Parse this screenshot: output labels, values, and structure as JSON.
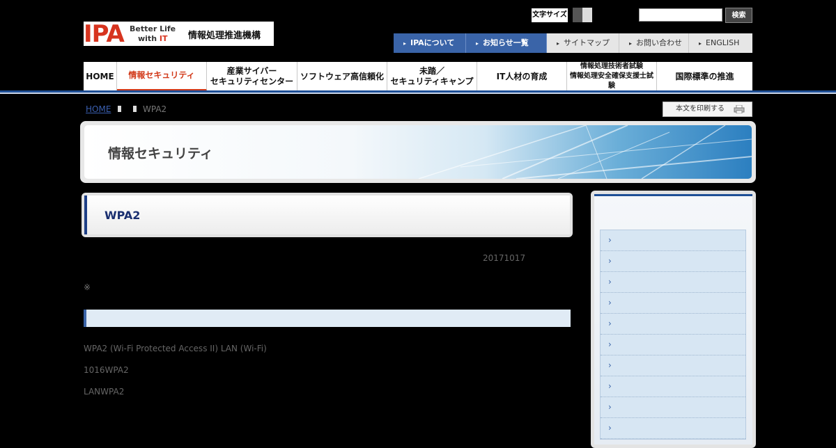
{
  "header": {
    "logo_main": "IPA",
    "logo_tagline_1": "Better Life",
    "logo_tagline_2_prefix": "with ",
    "logo_tagline_2_it": "IT",
    "logo_org": "情報処理推進機構",
    "font_size_label": "文字サイズ",
    "search": {
      "value": "",
      "button": "検索"
    }
  },
  "utility_nav": [
    {
      "label": "IPAについて",
      "style": "blue"
    },
    {
      "label": "お知らせ一覧",
      "style": "blue"
    },
    {
      "label": "サイトマップ",
      "style": "grey"
    },
    {
      "label": "お問い合わせ",
      "style": "grey"
    },
    {
      "label": "ENGLISH",
      "style": "grey"
    }
  ],
  "global_nav": [
    {
      "label": "HOME"
    },
    {
      "label": "情報セキュリティ",
      "active": true
    },
    {
      "label": "産業サイバー\nセキュリティセンター"
    },
    {
      "label": "ソフトウェア高信頼化"
    },
    {
      "label": "未踏／\nセキュリティキャンプ"
    },
    {
      "label": "IT人材の育成"
    },
    {
      "label": "情報処理技術者試験\n情報処理安全確保支援士試験",
      "small": true
    },
    {
      "label": "国際標準の推進"
    }
  ],
  "breadcrumb": {
    "home": "HOME",
    "current": "WPA2"
  },
  "print_label": "本文を印刷する",
  "banner_title": "情報セキュリティ",
  "page_title": "WPA2",
  "date": "20171017",
  "note": "※",
  "paragraphs": [
    "WPA2 (Wi-Fi Protected Access II)  LAN (Wi-Fi)",
    "1016WPA2",
    "LANWPA2"
  ],
  "sidebar_items": [
    "›",
    "›",
    "›",
    "›",
    "›",
    "›",
    "›",
    "›",
    "›",
    "›"
  ],
  "colors": {
    "brand_red": "#d7341f",
    "nav_blue": "#3a64a8",
    "title_navy": "#1a2f70"
  }
}
